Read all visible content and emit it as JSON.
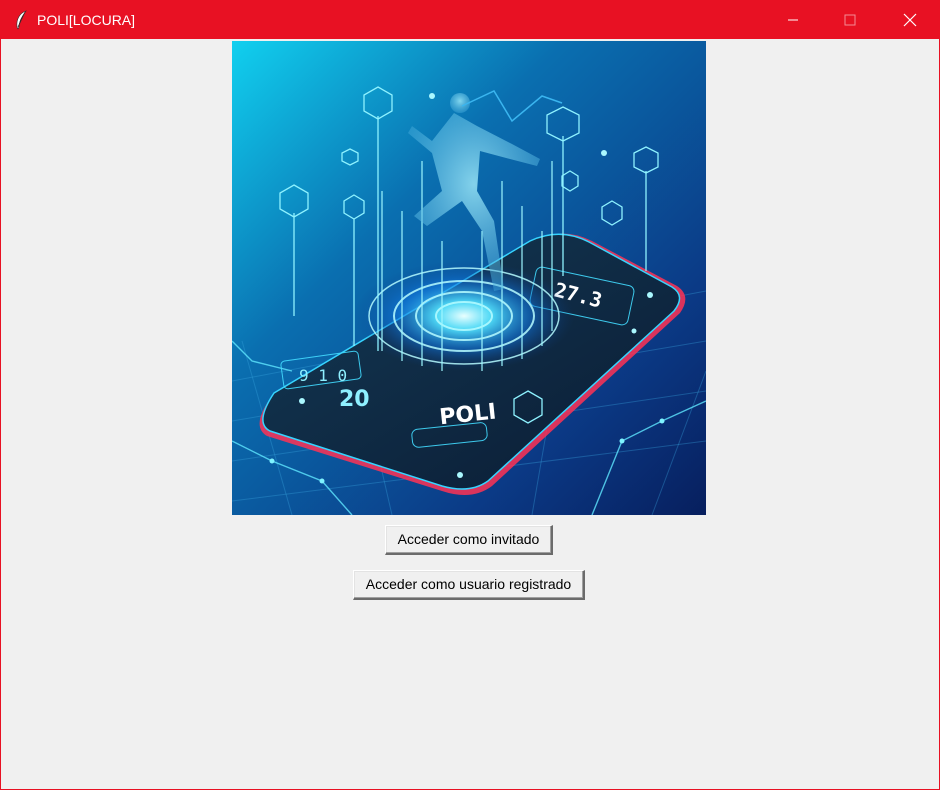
{
  "window": {
    "title": "POLI[LOCURA]",
    "titlebar_color": "#e81123",
    "background_color": "#f0f0f0"
  },
  "controls": {
    "minimize_icon": "minimize-icon",
    "maximize_icon": "maximize-icon",
    "close_icon": "close-icon"
  },
  "hero": {
    "description_icon": "hero-illustration",
    "phone_brand_text": "POLI",
    "phone_display_left": "9 1 0",
    "phone_display_number": "20",
    "phone_display_right": "27.3",
    "accent_color": "#00d7ff"
  },
  "buttons": {
    "guest_label": "Acceder como invitado",
    "registered_label": "Acceder como usuario registrado"
  }
}
